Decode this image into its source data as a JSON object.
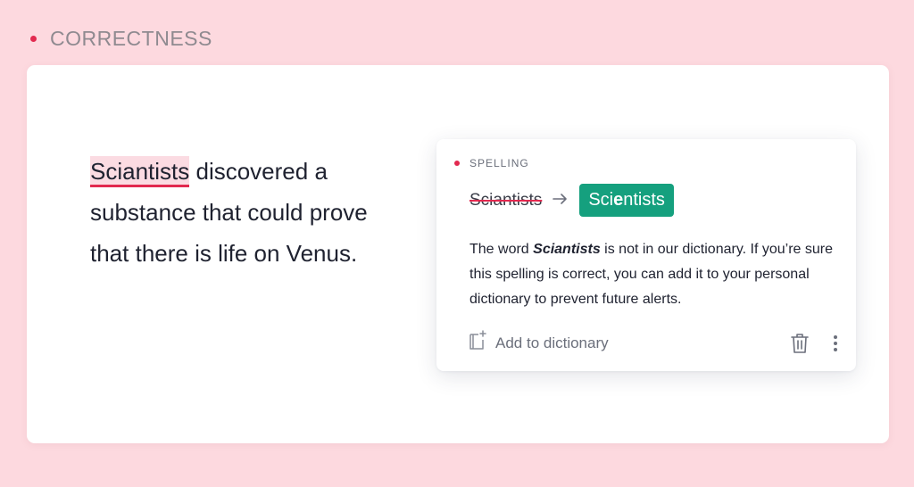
{
  "header": {
    "title": "CORRECTNESS"
  },
  "editor": {
    "flagged_word": "Sciantists",
    "rest_line1": " discovered a",
    "line2": "substance that could prove",
    "line3": "that there is life on Venus."
  },
  "suggestion": {
    "category": "SPELLING",
    "original": "Sciantists",
    "replacement_pre": "Sci",
    "replacement_hl": "e",
    "replacement_post": "ntists",
    "explanation_pre": "The word ",
    "explanation_word": "Sciantists",
    "explanation_post": " is not in our dictionary. If you’re sure this spelling is correct, you can add it to your personal dictionary to prevent future alerts.",
    "add_label": "Add to dictionary",
    "icons": {
      "add": "book-plus-icon",
      "delete": "trash-icon",
      "more": "more-vertical-icon",
      "arrow": "arrow-right-icon"
    }
  },
  "colors": {
    "accent_red": "#e2294f",
    "green": "#15a07e",
    "background": "#fdd9df"
  }
}
